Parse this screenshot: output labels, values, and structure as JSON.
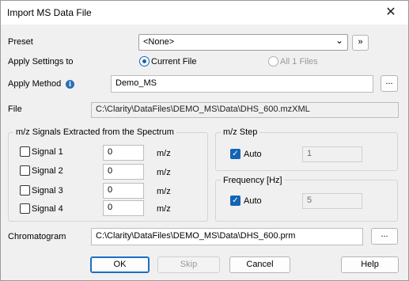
{
  "window": {
    "title": "Import MS Data File",
    "close_glyph": "✕"
  },
  "preset": {
    "label": "Preset",
    "value": "<None>",
    "more": "»"
  },
  "apply_settings": {
    "label": "Apply Settings to",
    "current_file": "Current File",
    "all_files": "All 1 Files"
  },
  "apply_method": {
    "label": "Apply Method",
    "info_glyph": "i",
    "value": "Demo_MS",
    "browse": "..."
  },
  "file": {
    "label": "File",
    "value": "C:\\Clarity\\DataFiles\\DEMO_MS\\Data\\DHS_600.mzXML"
  },
  "signals": {
    "title": "m/z Signals Extracted from the Spectrum",
    "items": [
      {
        "label": "Signal 1",
        "value": "0",
        "unit": "m/z"
      },
      {
        "label": "Signal 2",
        "value": "0",
        "unit": "m/z"
      },
      {
        "label": "Signal 3",
        "value": "0",
        "unit": "m/z"
      },
      {
        "label": "Signal 4",
        "value": "0",
        "unit": "m/z"
      }
    ]
  },
  "mz_step": {
    "title": "m/z Step",
    "auto_label": "Auto",
    "value": "1"
  },
  "frequency": {
    "title": "Frequency [Hz]",
    "auto_label": "Auto",
    "value": "5"
  },
  "chromatogram": {
    "label": "Chromatogram",
    "value": "C:\\Clarity\\DataFiles\\DEMO_MS\\Data\\DHS_600.prm",
    "browse": "..."
  },
  "buttons": {
    "ok": "OK",
    "skip": "Skip",
    "cancel": "Cancel",
    "help": "Help"
  },
  "icons": {
    "check_glyph": "✓",
    "chevron_glyph": "⌄"
  }
}
